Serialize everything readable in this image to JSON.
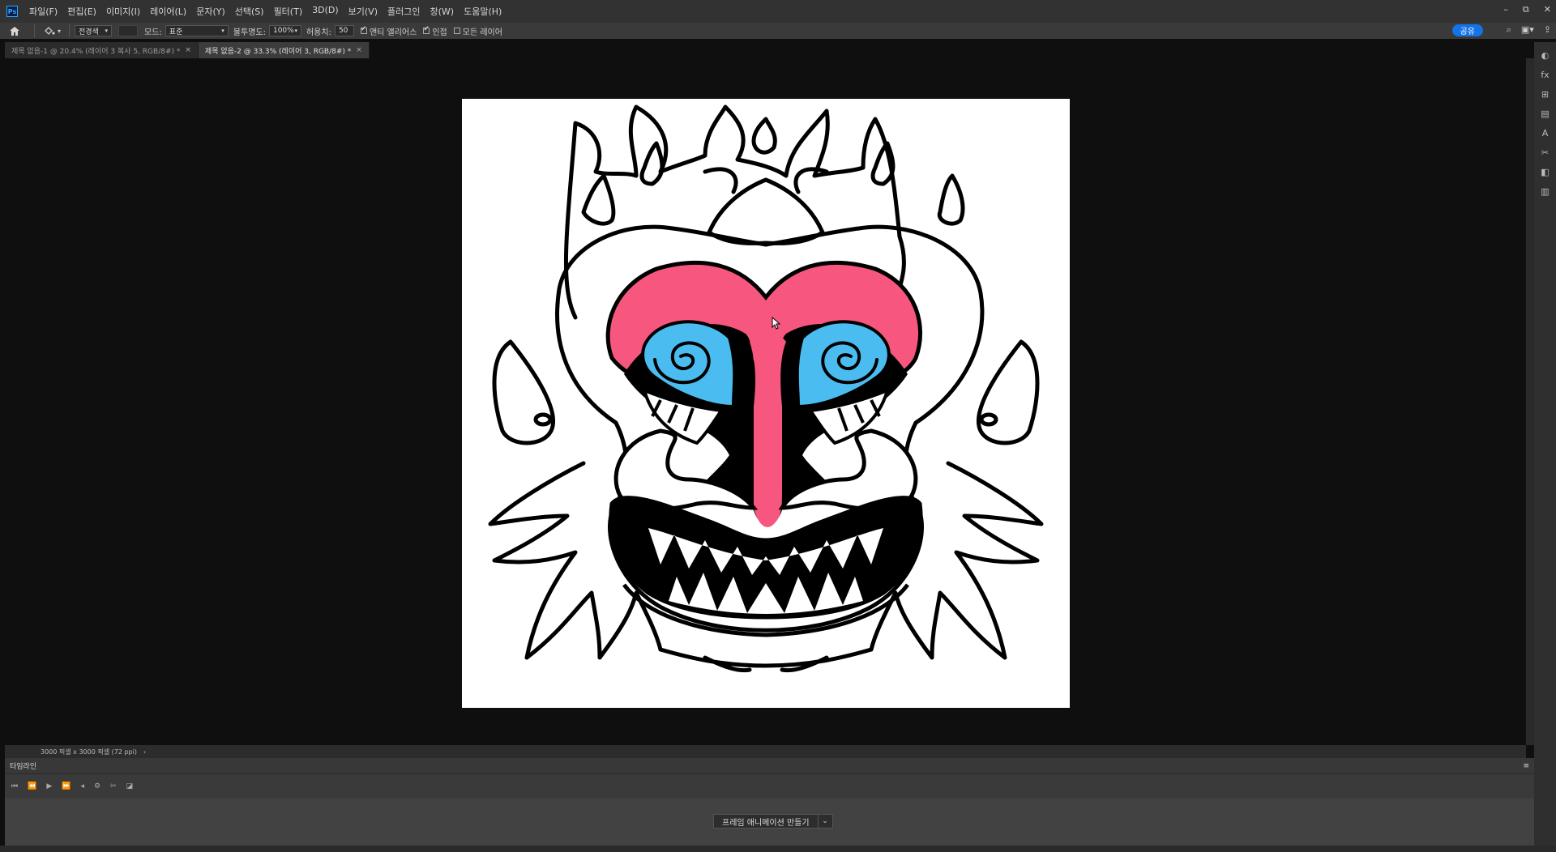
{
  "app": {
    "logo": "Ps"
  },
  "menu": [
    "파일(F)",
    "편집(E)",
    "이미지(I)",
    "레이어(L)",
    "문자(Y)",
    "선택(S)",
    "필터(T)",
    "3D(D)",
    "보기(V)",
    "플러그인",
    "창(W)",
    "도움말(H)"
  ],
  "window_controls": {
    "minimize": "–",
    "restore": "⧉",
    "close": "✕"
  },
  "options": {
    "fill_source": "전경색",
    "mode_label": "모드:",
    "mode_value": "표준",
    "opacity_label": "불투명도:",
    "opacity_value": "100%",
    "tolerance_label": "허용치:",
    "tolerance_value": "50",
    "antialias_label": "앤티 앨리어스",
    "antialias_checked": true,
    "contiguous_label": "인접",
    "contiguous_checked": true,
    "all_layers_label": "모든 레이어",
    "all_layers_checked": false,
    "share_label": "공유"
  },
  "tabs": [
    {
      "label": "제목 없음-1 @ 20.4% (레이어 3 복사 5, RGB/8#) *",
      "active": false
    },
    {
      "label": "제목 없음-2 @ 33.3% (레이어 3, RGB/8#) *",
      "active": true
    }
  ],
  "status": {
    "doc_info": "3000 픽셀 x 3000 픽셀 (72 ppi)",
    "arrow": "›"
  },
  "timeline": {
    "title": "타임라인",
    "create_button": "프레임 애니메이션 만들기",
    "dropdown_arrow": "⌄"
  },
  "colors": {
    "mask_pink": "#f7577e",
    "mask_blue": "#4bbcf0",
    "accent_share": "#1473e6"
  },
  "icons": [
    "home-icon",
    "paint-bucket-icon",
    "search-icon",
    "workspace-icon",
    "share-export-icon"
  ]
}
